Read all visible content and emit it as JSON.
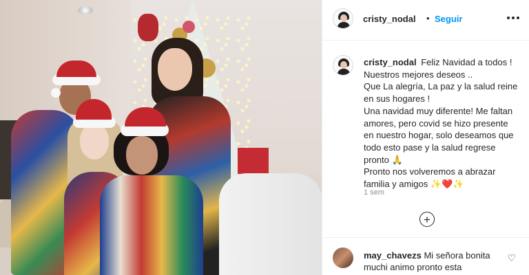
{
  "post": {
    "username": "cristy_nodal",
    "follow_label": "Seguir",
    "separator": "•",
    "caption_lines": [
      "Feliz Navidad a todos !",
      "Nuestros mejores deseos ..",
      "Que La alegría, La paz y la salud reine",
      "en sus hogares !",
      "Una navidad muy diferente! Me faltan",
      "amores, pero covid se hizo presente",
      "en nuestro hogar, solo deseamos que",
      "todo esto pase y la salud regrese",
      "pronto 🙏",
      "Pronto nos volveremos a abrazar",
      "familia y amigos ✨❤️✨"
    ],
    "time_ago": "1 sem",
    "load_more_icon": "plus-circle-icon",
    "more_icon": "more-options-icon"
  },
  "comment": {
    "username": "may_chavezs",
    "text_line1": "Mi señora bonita",
    "text_line2": "muchi animo pronto esta",
    "like_icon": "heart-outline-icon"
  },
  "photo": {
    "subject": "family-christmas-photo"
  },
  "colors": {
    "link_blue": "#0095f6",
    "text": "#262626",
    "muted": "#8e8e8e",
    "border": "#efefef"
  }
}
